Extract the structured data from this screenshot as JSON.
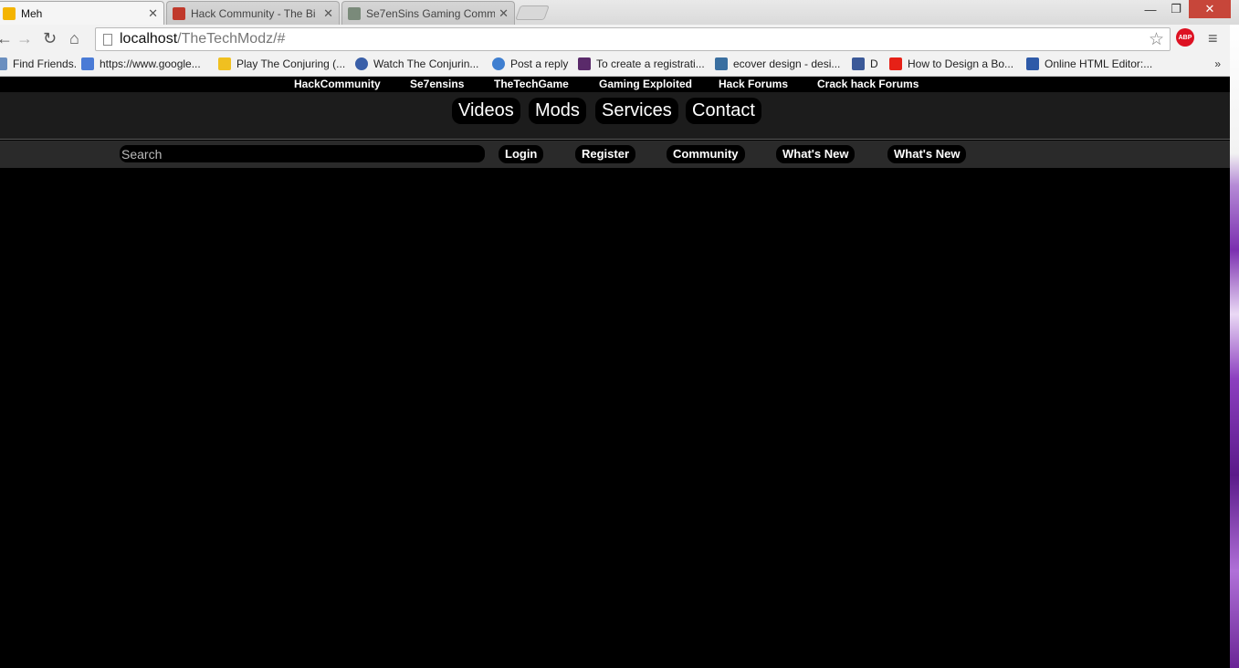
{
  "browser": {
    "tabs": [
      {
        "title": "Meh",
        "active": true
      },
      {
        "title": "Hack Community - The Bi",
        "active": false
      },
      {
        "title": "Se7enSins Gaming Comm",
        "active": false
      }
    ],
    "url_host": "localhost",
    "url_path": "/TheTechModz/#",
    "abp_label": "ABP",
    "bookmarks": [
      {
        "label": "Find Friends."
      },
      {
        "label": "https://www.google..."
      },
      {
        "label": "Play The Conjuring (..."
      },
      {
        "label": "Watch The Conjurin..."
      },
      {
        "label": "Post a reply"
      },
      {
        "label": "To create a registrati..."
      },
      {
        "label": "ecover design - desi..."
      },
      {
        "label": "D"
      },
      {
        "label": "How to Design a Bo..."
      },
      {
        "label": "Online HTML Editor:..."
      }
    ],
    "bookmarks_more": "»"
  },
  "site": {
    "top_links": [
      "HackCommunity",
      "Se7ensins",
      "TheTechGame",
      "Gaming Exploited",
      "Hack Forums",
      "Crack hack Forums"
    ],
    "main_nav": [
      "Videos",
      "Mods",
      "Services",
      "Contact"
    ],
    "search_placeholder": "Search",
    "sub_nav": [
      "Login",
      "Register",
      "Community",
      "What's New",
      "What's New"
    ]
  },
  "colors": {
    "page_bg": "#000000",
    "nav_bg": "#1c1c1c",
    "subnav_bg": "#2a2a2a",
    "pill_bg": "#000000",
    "text": "#ffffff"
  }
}
